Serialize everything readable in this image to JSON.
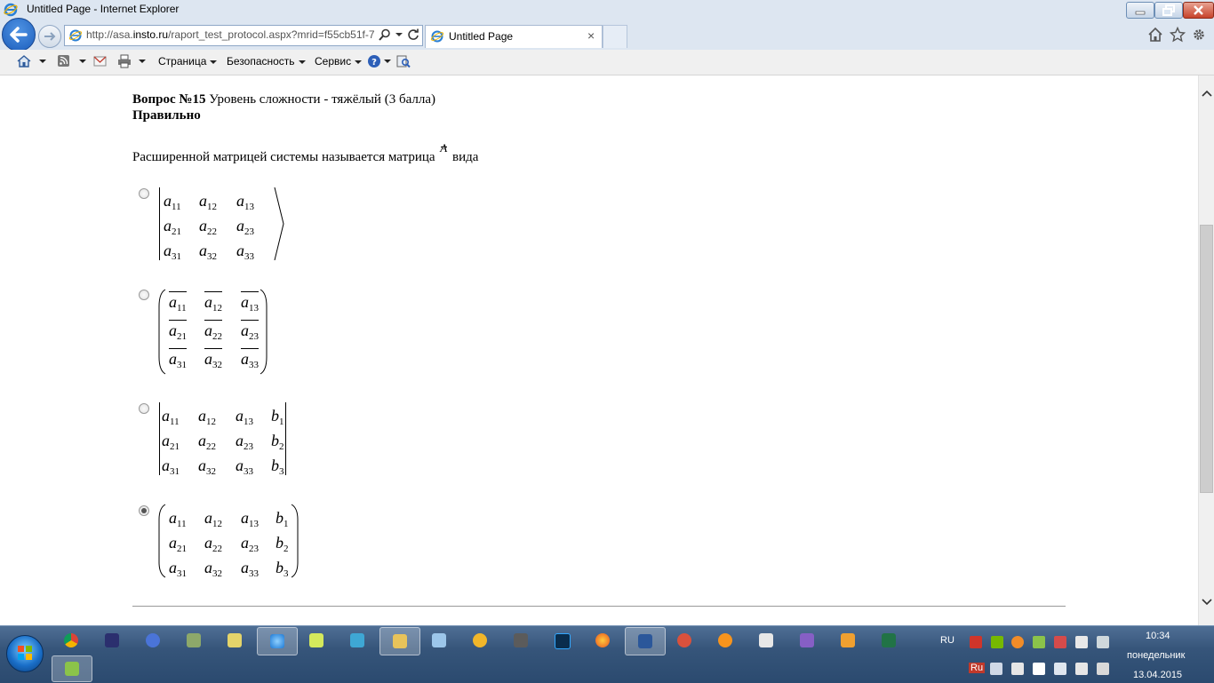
{
  "window": {
    "title": "Untitled Page - Internet Explorer"
  },
  "browser": {
    "url_prefix": "http://asa.",
    "url_domain": "insto.ru",
    "url_rest": "/raport_test_protocol.aspx?mrid=f55cb51f-7",
    "tab_title": "Untitled Page",
    "tab_close": "×"
  },
  "commandbar": {
    "page_menu": "Страница",
    "safety_menu": "Безопасность",
    "tools_menu": "Сервис"
  },
  "question": {
    "number_label": "Вопрос №15",
    "difficulty": " Уровень сложности - тяжёлый (3 балла)",
    "status": "Правильно",
    "text_before": "Расширенной матрицей системы называется матрица ",
    "matrix_symbol": "A",
    "text_after": " вида",
    "options": [
      {
        "selected": false,
        "cells": [
          [
            "a",
            "11"
          ],
          [
            "a",
            "12"
          ],
          [
            "a",
            "13"
          ],
          [
            "a",
            "21"
          ],
          [
            "a",
            "22"
          ],
          [
            "a",
            "23"
          ],
          [
            "a",
            "31"
          ],
          [
            "a",
            "32"
          ],
          [
            "a",
            "33"
          ]
        ]
      },
      {
        "selected": false,
        "cells": [
          [
            "a",
            "11"
          ],
          [
            "a",
            "12"
          ],
          [
            "a",
            "13"
          ],
          [
            "a",
            "21"
          ],
          [
            "a",
            "22"
          ],
          [
            "a",
            "23"
          ],
          [
            "a",
            "31"
          ],
          [
            "a",
            "32"
          ],
          [
            "a",
            "33"
          ]
        ]
      },
      {
        "selected": false,
        "cells": [
          [
            "a",
            "11"
          ],
          [
            "a",
            "12"
          ],
          [
            "a",
            "13"
          ],
          [
            "b",
            "1"
          ],
          [
            "a",
            "21"
          ],
          [
            "a",
            "22"
          ],
          [
            "a",
            "23"
          ],
          [
            "b",
            "2"
          ],
          [
            "a",
            "31"
          ],
          [
            "a",
            "32"
          ],
          [
            "a",
            "33"
          ],
          [
            "b",
            "3"
          ]
        ]
      },
      {
        "selected": true,
        "cells": [
          [
            "a",
            "11"
          ],
          [
            "a",
            "12"
          ],
          [
            "a",
            "13"
          ],
          [
            "b",
            "1"
          ],
          [
            "a",
            "21"
          ],
          [
            "a",
            "22"
          ],
          [
            "a",
            "23"
          ],
          [
            "b",
            "2"
          ],
          [
            "a",
            "31"
          ],
          [
            "a",
            "32"
          ],
          [
            "a",
            "33"
          ],
          [
            "b",
            "3"
          ]
        ]
      }
    ]
  },
  "tray": {
    "lang_top": "RU",
    "lang_bottom": "Ru",
    "time": "10:34",
    "day": "понедельник",
    "date": "13.04.2015"
  },
  "colors": {
    "chrome": "#dde6f1",
    "taskbar": "#36557a",
    "accent": "#1b5dbc"
  }
}
